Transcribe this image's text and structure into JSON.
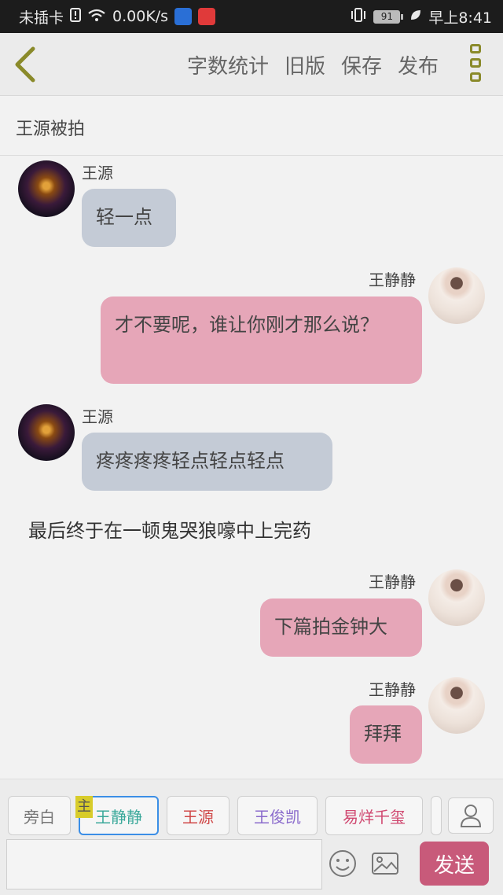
{
  "status_bar": {
    "carrier": "未插卡",
    "speed": "0.00K/s",
    "battery": "91",
    "time": "早上8:41"
  },
  "toolbar": {
    "word_count": "字数统计",
    "old_version": "旧版",
    "save": "保存",
    "publish": "发布",
    "accent_color": "#8a8a2a"
  },
  "story": {
    "title": "王源被拍"
  },
  "messages": [
    {
      "name": "王源",
      "text": "轻一点"
    },
    {
      "name": "王静静",
      "text": "才不要呢，谁让你刚才那么说？"
    },
    {
      "name": "王源",
      "text": "疼疼疼疼轻点轻点轻点"
    },
    {
      "narration": "最后终于在一顿鬼哭狼嚎中上完药"
    },
    {
      "name": "王静静",
      "text": "下篇拍金钟大"
    },
    {
      "name": "王静静",
      "text": "拜拜"
    }
  ],
  "roles": {
    "items": [
      {
        "label": "旁白",
        "color": "#777777"
      },
      {
        "label": "王静静",
        "color": "#3aa89a"
      },
      {
        "label": "王源",
        "color": "#d04848"
      },
      {
        "label": "王俊凯",
        "color": "#8a6acc"
      },
      {
        "label": "易烊千玺",
        "color": "#d04870"
      }
    ],
    "main_badge": "主"
  },
  "composer": {
    "placeholder": "",
    "send_label": "发送",
    "send_color": "#c85a7a"
  }
}
